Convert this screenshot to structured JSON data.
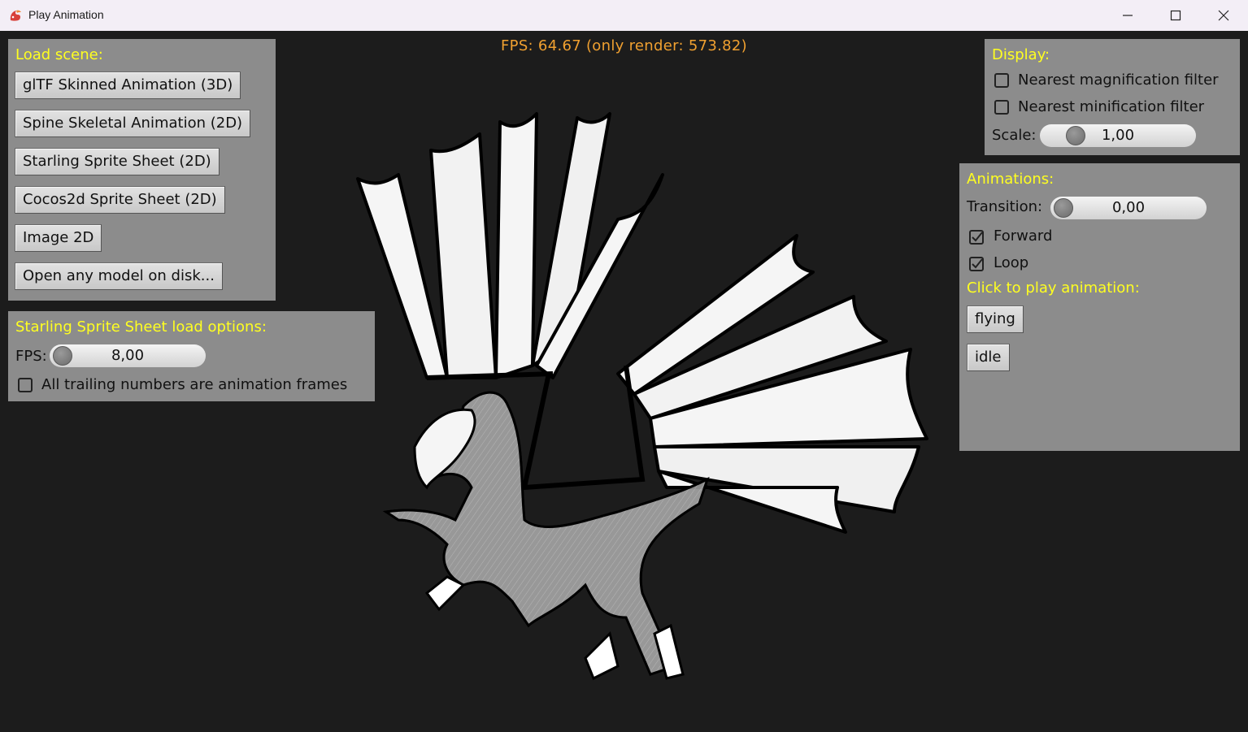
{
  "window": {
    "title": "Play Animation",
    "icon": "dragon-app-icon"
  },
  "fps_text": "FPS: 64.67 (only render: 573.82)",
  "load_scene": {
    "title": "Load scene:",
    "buttons": [
      "glTF Skinned Animation (3D)",
      "Spine Skeletal Animation (2D)",
      "Starling Sprite Sheet (2D)",
      "Cocos2d Sprite Sheet (2D)",
      "Image 2D",
      "Open any model on disk..."
    ]
  },
  "starling_options": {
    "title": "Starling Sprite Sheet load options:",
    "fps_label": "FPS:",
    "fps_value": "8,00",
    "trailing_label": "All trailing numbers are animation frames",
    "trailing_checked": false
  },
  "display": {
    "title": "Display:",
    "nearest_mag_label": "Nearest magnification filter",
    "nearest_mag_checked": false,
    "nearest_min_label": "Nearest minification filter",
    "nearest_min_checked": false,
    "scale_label": "Scale:",
    "scale_value": "1,00"
  },
  "animations": {
    "title": "Animations:",
    "transition_label": "Transition:",
    "transition_value": "0,00",
    "forward_label": "Forward",
    "forward_checked": true,
    "loop_label": "Loop",
    "loop_checked": true,
    "play_title": "Click to play animation:",
    "buttons": [
      "flying",
      "idle"
    ]
  },
  "colors": {
    "panel": "#8c8c8c",
    "panel_title": "#ffff20",
    "fps_text": "#f0a030",
    "background": "#1c1c1c"
  }
}
